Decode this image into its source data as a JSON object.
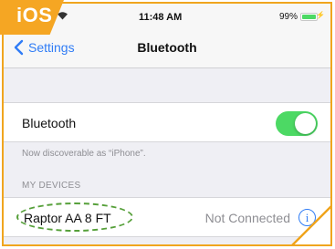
{
  "badge": {
    "label": "iOS",
    "color": "#f5a623"
  },
  "status_bar": {
    "time": "11:48 AM",
    "battery": "99%",
    "battery_level": 0.99,
    "signal_icon": "wifi-icon",
    "charging_icon": "charging-bolt-icon"
  },
  "nav": {
    "back_label": "Settings",
    "back_icon": "chevron-left-icon",
    "title": "Bluetooth"
  },
  "bluetooth": {
    "label": "Bluetooth",
    "enabled": true,
    "toggle_color": "#4cd964",
    "discoverable_note": "Now discoverable as “iPhone”."
  },
  "devices": {
    "header": "MY DEVICES",
    "items": [
      {
        "name": "Raptor AA 8 FT",
        "status": "Not Connected",
        "info_icon": "info-icon"
      }
    ]
  },
  "colors": {
    "accent": "#2f7cf6",
    "frame": "#f0a51e",
    "highlight": "#56a03a"
  }
}
